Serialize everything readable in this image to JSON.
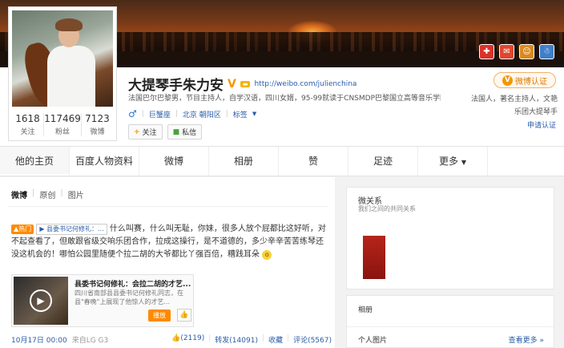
{
  "banner": {
    "icons": [
      {
        "name": "medical-badge-icon",
        "glyph": "✚",
        "color": "#d9322a"
      },
      {
        "name": "stamp-badge-icon",
        "glyph": "✉",
        "color": "#e0462e"
      },
      {
        "name": "vip-face-badge-icon",
        "glyph": "☺",
        "color": "#d98a1f"
      },
      {
        "name": "user-badge-icon",
        "glyph": "☃",
        "color": "#3f7ec9"
      }
    ]
  },
  "profile": {
    "name": "大提琴手朱力安",
    "verified_mark": "V",
    "url": "http://weibo.com/julienchina",
    "bio": "法国巴尔巴黎男，节目主持人，自学汉语，四川女婿，95-99就读于CNSMDP巴黎国立高等音乐学院...",
    "gender_symbol": "♂",
    "tags": [
      "巨蟹座",
      "北京 朝阳区",
      "标签"
    ],
    "follow_label": "关注",
    "message_label": "私信",
    "counts": [
      {
        "num": "1618",
        "label": "关注"
      },
      {
        "num": "117469",
        "label": "粉丝"
      },
      {
        "num": "7123",
        "label": "微博"
      }
    ],
    "verify_label": "微博认证",
    "verify_lines": [
      "法国人，著名主持人，文艳",
      "乐团大提琴手"
    ],
    "verify_link": "申请认证"
  },
  "tabs": [
    "他的主页",
    "百度人物资料",
    "微博",
    "相册",
    "赞",
    "足迹",
    "更多"
  ],
  "feed": {
    "subtabs": [
      "微博",
      "原创",
      "图片"
    ],
    "post": {
      "hot_label": "热门",
      "video_label": "县委书记何修礼：...",
      "text": "什么叫赛，什么叫无耻，你妹，很多人放个屁都比这好听，对不起查看了，但敢跟省级交响乐团合作，拉成这操行，是不道德的，多少辛辛苦苦练琴还没这机会的！哪怕公园里随便个拉二胡的大爷都比丫强百倍，糟践耳朵",
      "emoji": "😲"
    },
    "card": {
      "title": "县委书记何修礼：会拉二胡的才艺...",
      "desc": "四川省南部县县委书记何修礼同志，在县\"春晚\"上展现了他惊人的才艺...",
      "play_label": "播放"
    },
    "footer": {
      "date": "10月17日 00:00",
      "source": "来自LG G3",
      "likes": "(2119)",
      "repost": "转发(14091)",
      "favorite": "收藏",
      "comment": "评论(5567)"
    }
  },
  "side": {
    "relation_title": "微关系",
    "relation_sub": "我们之间的共同关系",
    "album_title": "相册",
    "album_personal": "个人图片",
    "album_more": "查看更多 »"
  }
}
